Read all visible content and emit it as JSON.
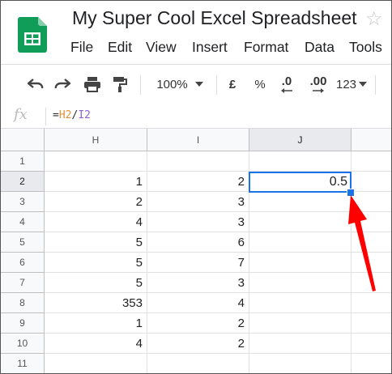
{
  "app": {
    "title": "My Super Cool Excel Spreadsheet",
    "icons": {
      "logo": "google-sheets-logo",
      "star": "star-outline-icon"
    }
  },
  "menu": [
    "File",
    "Edit",
    "View",
    "Insert",
    "Format",
    "Data",
    "Tools"
  ],
  "toolbar": {
    "zoom": "100%",
    "currency": "£",
    "percent": "%",
    "decrease_decimals": ".0",
    "increase_decimals": ".00",
    "more_formats": "123",
    "icons": [
      "undo-icon",
      "redo-icon",
      "print-icon",
      "paint-format-icon",
      "zoom-dropdown-icon",
      "format-dropdown-icon"
    ]
  },
  "formula_bar": {
    "fx_label": "fx",
    "eq": "=",
    "ref1": "H2",
    "op": "/",
    "ref2": "I2",
    "ref1_color": "#e69138",
    "ref2_color": "#8e63ce"
  },
  "grid": {
    "columns": [
      "H",
      "I",
      "J"
    ],
    "selected_column": "J",
    "rows": [
      {
        "num": "1",
        "H": "",
        "I": "",
        "J": ""
      },
      {
        "num": "2",
        "H": "1",
        "I": "2",
        "J": "0.5"
      },
      {
        "num": "3",
        "H": "2",
        "I": "3",
        "J": ""
      },
      {
        "num": "4",
        "H": "4",
        "I": "3",
        "J": ""
      },
      {
        "num": "5",
        "H": "5",
        "I": "6",
        "J": ""
      },
      {
        "num": "6",
        "H": "5",
        "I": "7",
        "J": ""
      },
      {
        "num": "7",
        "H": "5",
        "I": "3",
        "J": ""
      },
      {
        "num": "8",
        "H": "353",
        "I": "4",
        "J": ""
      },
      {
        "num": "9",
        "H": "1",
        "I": "2",
        "J": ""
      },
      {
        "num": "10",
        "H": "4",
        "I": "2",
        "J": ""
      },
      {
        "num": "11",
        "H": "",
        "I": "",
        "J": ""
      }
    ],
    "active_cell": {
      "ref": "J2",
      "value": "0.5"
    },
    "selection_color": "#1a73e8",
    "annotation": "red-arrow-pointing-to-fill-handle",
    "annotation_color": "#ff0000"
  }
}
